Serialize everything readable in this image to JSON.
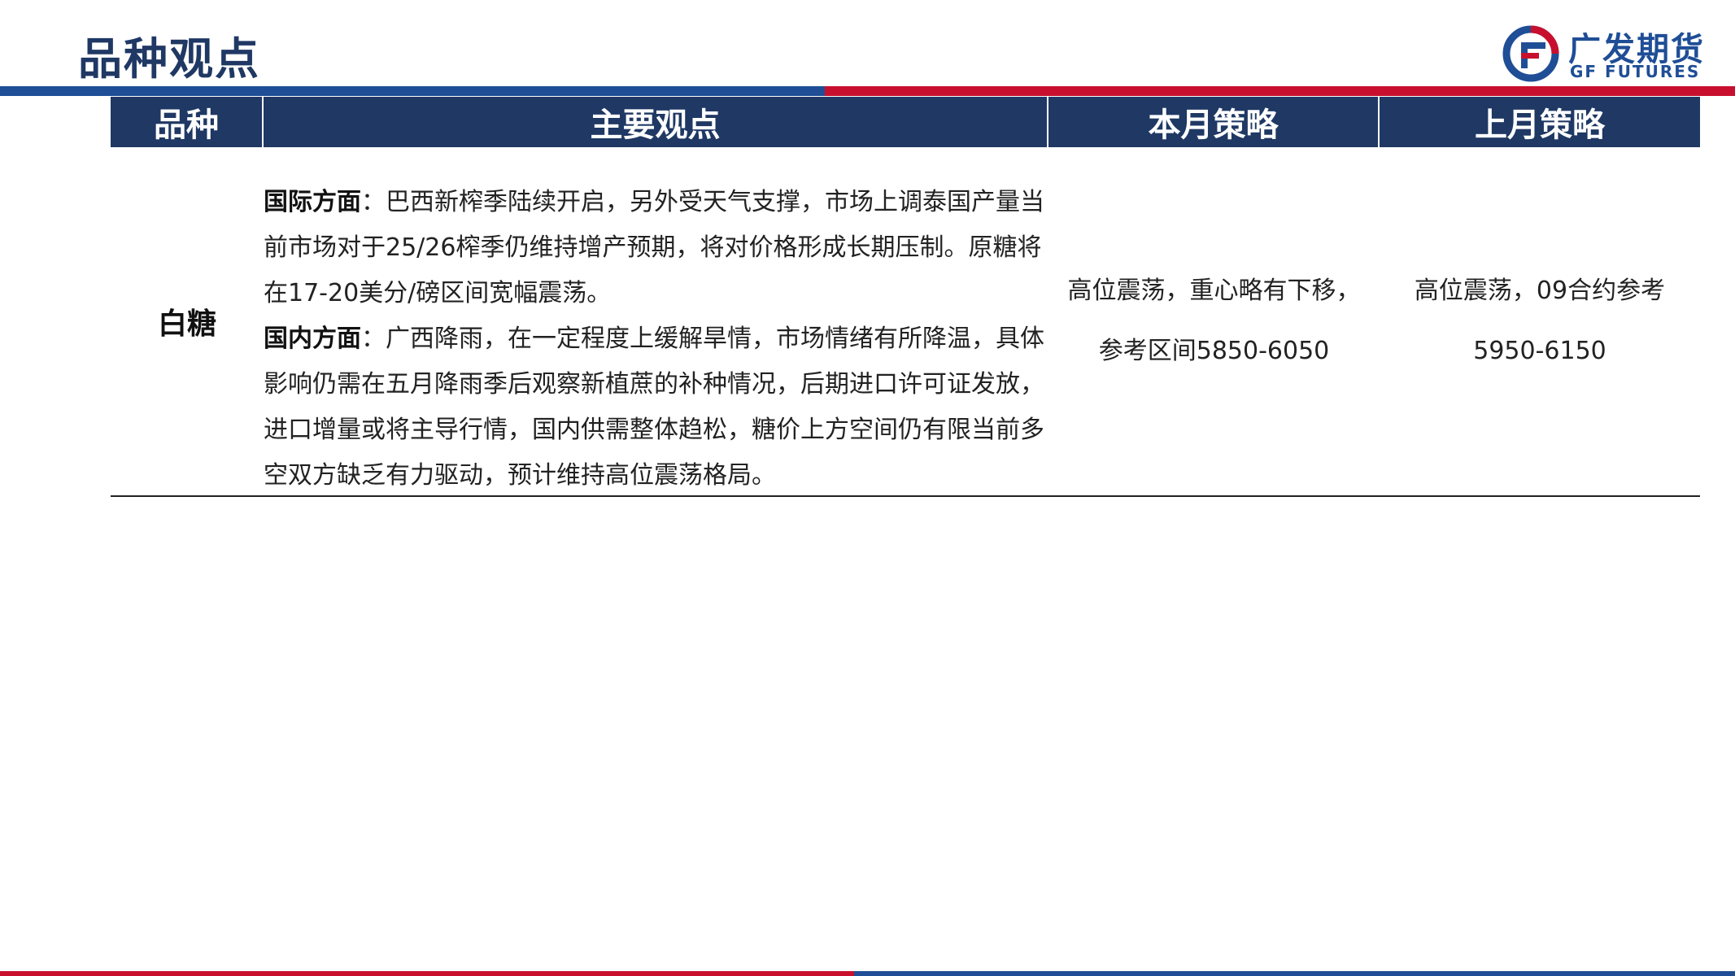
{
  "page": {
    "title": "品种观点"
  },
  "logo": {
    "cn": "广发期货",
    "en": "GF FUTURES"
  },
  "colors": {
    "navy": "#1f3864",
    "blue": "#1f4e96",
    "red": "#c8102e"
  },
  "table": {
    "headers": [
      "品种",
      "主要观点",
      "本月策略",
      "上月策略"
    ],
    "rows": [
      {
        "variety": "白糖",
        "intl_label": "国际方面",
        "intl_text": "：巴西新榨季陆续开启，另外受天气支撑，市场上调泰国产量当前市场对于25/26榨季仍维持增产预期，将对价格形成长期压制。原糖将在17-20美分/磅区间宽幅震荡。",
        "dom_label": "国内方面",
        "dom_text": "：广西降雨，在一定程度上缓解旱情，市场情绪有所降温，具体影响仍需在五月降雨季后观察新植蔗的补种情况，后期进口许可证发放，进口增量或将主导行情，国内供需整体趋松，糖价上方空间仍有限当前多空双方缺乏有力驱动，预计维持高位震荡格局。",
        "this_month": [
          "高位震荡，重心略有下移，",
          "参考区间5850-6050"
        ],
        "last_month": [
          "高位震荡，09合约参考",
          "5950-6150"
        ]
      }
    ]
  }
}
